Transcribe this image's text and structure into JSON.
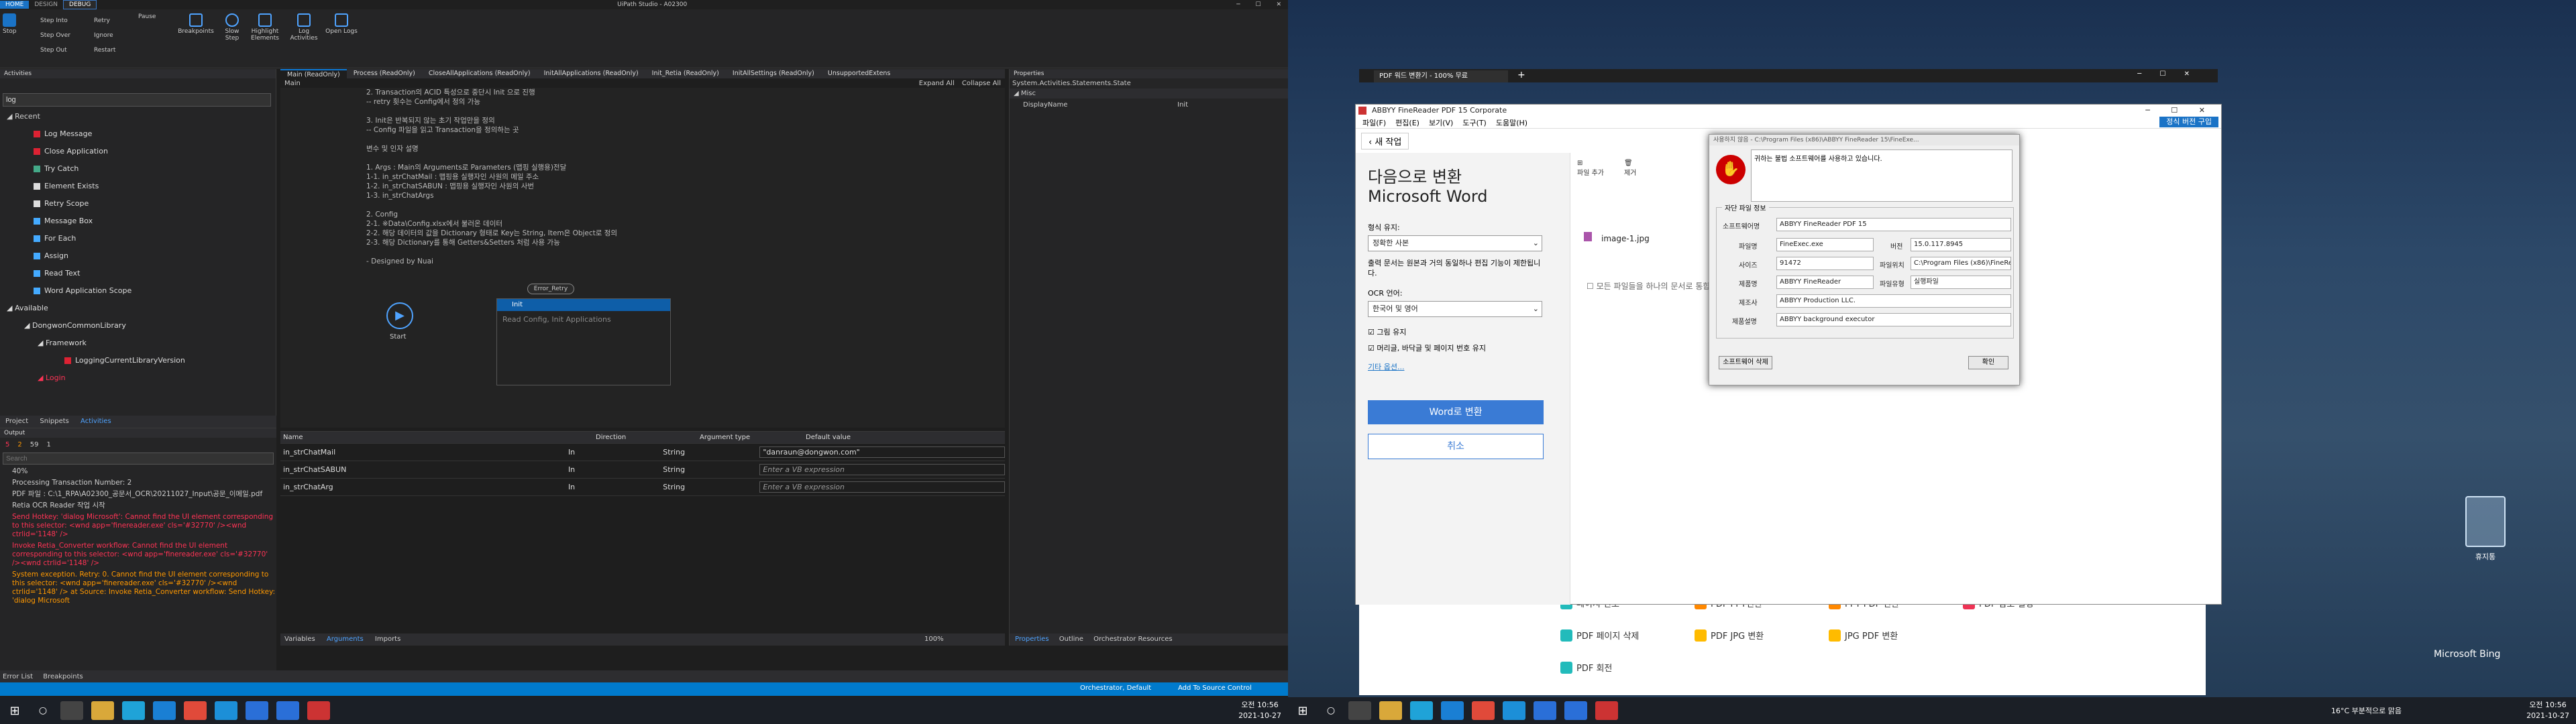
{
  "uipath": {
    "title": "UiPath Studio - A02300",
    "tabs": [
      "HOME",
      "DESIGN",
      "DEBUG"
    ],
    "ribbon": {
      "stop": "Stop",
      "step_into": "Step Into",
      "step_over": "Step Over",
      "step_out": "Step Out",
      "retry": "Retry",
      "ignore": "Ignore",
      "restart": "Restart",
      "pause": "Pause",
      "breakpoints": "Breakpoints",
      "slow_step": "Slow Step",
      "highlight": "Highlight Elements",
      "log_activities": "Log Activities",
      "open_logs": "Open Logs"
    },
    "activities": {
      "header": "Activities",
      "search": "log",
      "recent": "Recent",
      "items": [
        "Log Message",
        "Close Application",
        "Try Catch",
        "Element Exists",
        "Retry Scope",
        "Message Box",
        "For Each",
        "Assign",
        "Read Text",
        "Word Application Scope"
      ],
      "available": "Available",
      "lib": "DongwonCommonLibrary",
      "framework": "Framework",
      "logging": "LoggingCurrentLibraryVersion",
      "login": "Login"
    },
    "bottom_tabs": [
      "Project",
      "Snippets",
      "Activities"
    ],
    "output": {
      "header": "Output",
      "counts": [
        "5",
        "2",
        "59",
        "1"
      ],
      "search": "Search",
      "lines": [
        {
          "t": "40%",
          "c": "n"
        },
        {
          "t": "Processing Transaction Number: 2",
          "c": "n"
        },
        {
          "t": "PDF 파일 : C:\\1_RPA\\A02300_공문서_OCR\\20211027_Input\\공문_이메일.pdf",
          "c": "n"
        },
        {
          "t": "Retia OCR Reader 작업 시작",
          "c": "n"
        },
        {
          "t": "Send Hotkey: 'dialog Microsoft': Cannot find the UI element corresponding to this selector: <wnd app='finereader.exe' cls='#32770' /><wnd ctrlid='1148' />",
          "c": "e"
        },
        {
          "t": "Invoke Retia_Converter workflow: Cannot find the UI element corresponding to this selector: <wnd app='finereader.exe' cls='#32770' /><wnd ctrlid='1148' />",
          "c": "e"
        },
        {
          "t": "System exception. Retry: 0. Cannot find the UI element corresponding to this selector: <wnd app='finereader.exe' cls='#32770' /><wnd ctrlid='1148' /> at Source: Invoke Retia_Converter workflow: Send Hotkey: 'dialog Microsoft",
          "c": "w"
        }
      ]
    },
    "doc_tabs": [
      "Main (ReadOnly)",
      "Process (ReadOnly)",
      "CloseAllApplications (ReadOnly)",
      "InitAllApplications (ReadOnly)",
      "Init_Retia (ReadOnly)",
      "InitAllSettings (ReadOnly)",
      "UnsupportedExtens"
    ],
    "breadcrumb": "Main",
    "expand": "Expand All",
    "collapse": "Collapse All",
    "annotation": "2. Transaction의 ACID 특성으로 중단시 Init 으로 진행\n-- retry 횟수는 Config에서 정의 가능\n\n3. Init은 반복되지 않는 초기 작업만을 정의\n-- Config 파일을 읽고 Transaction을 정의하는 곳\n\n변수 및 인자 설명\n\n1. Args : Main의 Arguments로 Parameters (맵핑 실행용)전달\n1-1. in_strChatMail : 맵핑용 실행자인 사원의 메일 주소\n1-2. in_strChatSABUN : 맵핑용 실행자인 사원의 사번\n1-3. in_strChatArgs\n\n2. Config\n2-1. ※Data\\Config.xlsx에서 불러온 데이터\n2-2. 해당 데이터의 값을 Dictionary 형태로 Key는 String, Item은 Object로 정의\n2-3. 해당 Dictionary를 통해 Getters&Setters 처럼 사용 가능\n\n- Designed by Nuai",
    "flow": {
      "start": "Start",
      "init": "Init",
      "init_desc": "Read Config, Init Applications",
      "error": "Error_Retry"
    },
    "args": {
      "headers": [
        "Name",
        "Direction",
        "Argument type",
        "Default value"
      ],
      "rows": [
        [
          "in_strChatMail",
          "In",
          "String",
          "\"danraun@dongwon.com\""
        ],
        [
          "in_strChatSABUN",
          "In",
          "String",
          "Enter a VB expression"
        ],
        [
          "in_strChatArg",
          "In",
          "String",
          "Enter a VB expression"
        ]
      ]
    },
    "args_tabs": [
      "Variables",
      "Arguments",
      "Imports"
    ],
    "zoom": "100%",
    "props": {
      "header": "Properties",
      "type": "System.Activities.Statements.State",
      "misc": "Misc",
      "display_name": "DisplayName",
      "display_val": "Init"
    },
    "props_tabs": [
      "Properties",
      "Outline",
      "Orchestrator Resources"
    ],
    "status": [
      "Error List",
      "Breakpoints"
    ],
    "bar": {
      "orchestrator": "Orchestrator, Default",
      "source": "Add To Source Control"
    }
  },
  "taskbar1": {
    "time": "오전 10:56",
    "date": "2021-10-27"
  },
  "taskbar2": {
    "weather": "16°C 부분적으로 맑음",
    "time": "오전 10:56",
    "date": "2021-10-27"
  },
  "desktop": {
    "recycle": "휴지통",
    "bing": "Microsoft Bing"
  },
  "edge": {
    "tab": "PDF 워드 변환기 - 100% 무료",
    "tools": [
      "페이지 번호",
      "PDF PPT변환",
      "PPT PDF 변환",
      "PDF 암호 설정",
      "PDF 페이지 삭제",
      "PDF JPG 변환",
      "JPG PDF 변환",
      "PDF 회전"
    ]
  },
  "abbyy": {
    "title": "ABBYY FineReader PDF 15 Corporate",
    "menu": [
      "파일(F)",
      "편집(E)",
      "보기(V)",
      "도구(T)",
      "도움말(H)"
    ],
    "buy": "정식 버전 구입",
    "new_task": "새 작업",
    "heading1": "다음으로 변환",
    "heading2": "Microsoft Word",
    "format_label": "형식 유지:",
    "format_val": "정확한 사본",
    "format_desc": "출력 문서는 원본과 거의 동일하나 편집 기능이 제한됩니다.",
    "ocr_label": "OCR 언어:",
    "ocr_val": "한국어 및 영어",
    "chk_image": "그림 유지",
    "chk_header": "머리글, 바닥글 및 페이지 번호 유지",
    "more": "기타 옵션...",
    "convert": "Word로 변환",
    "cancel": "취소",
    "toolbar": [
      "파일 추가",
      "제거"
    ],
    "file": "image-1.jpg",
    "merge": "모든 파일들을 하나의 문서로 통합"
  },
  "dialog": {
    "title": "사용하지 않음 - C:\\Program Files (x86)\\ABBYY FineReader 15\\FineExe...",
    "message": "귀하는 불법 소프트웨어를 사용하고 있습니다.",
    "group": "자단 파일 정보",
    "labels": [
      "소프트웨어명",
      "파일명",
      "버전",
      "사이즈",
      "파일위치",
      "제품명",
      "파일유형",
      "제조사",
      "제품설명"
    ],
    "values": [
      "ABBYY FineReader PDF 15",
      "FineExec.exe",
      "15.0.117.8945",
      "91472",
      "C:\\Program Files (x86)\\FineRe",
      "ABBYY FineReader",
      "실행파일",
      "ABBYY Production LLC.",
      "ABBYY background executor"
    ],
    "btn_software": "소프트웨어 삭제",
    "btn_ok": "확인"
  }
}
